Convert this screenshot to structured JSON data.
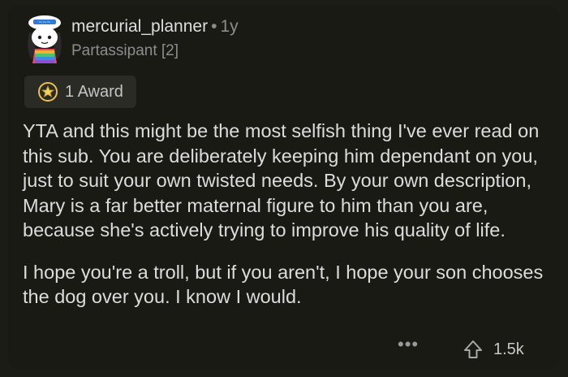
{
  "comment": {
    "username": "mercurial_planner",
    "separator": "•",
    "age": "1y",
    "flair": "Partassipant [2]",
    "award_label": "1 Award",
    "paragraphs": [
      "YTA and this might be the most selfish thing I've ever read on this sub.  You are deliberately keeping him dependant on you, just to suit your own twisted needs.  By your own description, Mary is a far better maternal figure to him than you are, because she's actively trying to improve his quality of life.",
      "I hope you're a troll, but if you aren't, I hope your son chooses the dog over you.  I know I would."
    ],
    "more_label": "•••",
    "vote_count": "1.5k"
  },
  "icons": {
    "avatar": "snoo-avatar",
    "award": "award-star-icon",
    "more": "more-options-icon",
    "upvote": "upvote-arrow-icon"
  },
  "colors": {
    "background": "#1a1a14",
    "text": "#dcdcdc",
    "muted": "#8c8c8c",
    "award_badge": "#2b2b25"
  }
}
